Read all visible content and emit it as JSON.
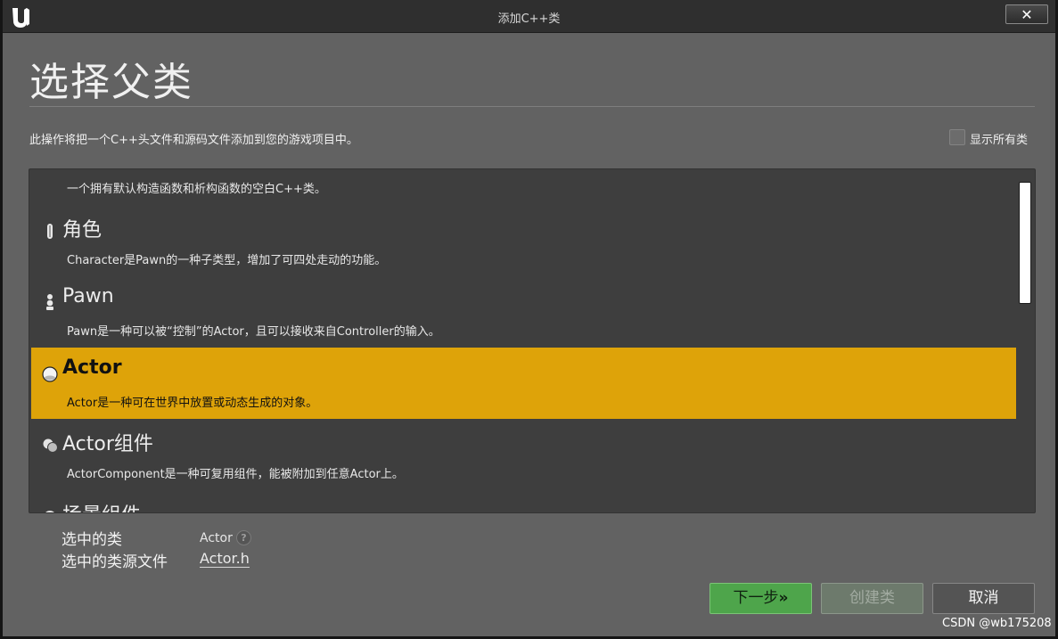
{
  "window": {
    "title": "添加C++类",
    "close_label": "✕"
  },
  "header": {
    "heading": "选择父类",
    "description": "此操作将把一个C++头文件和源码文件添加到您的游戏项目中。",
    "show_all_label": "显示所有类",
    "show_all_checked": false
  },
  "class_list": {
    "items": [
      {
        "name": "",
        "description": "一个拥有默认构造函数和析构函数的空白C++类。",
        "icon": "none-partial"
      },
      {
        "name": "角色",
        "description": "Character是Pawn的一种子类型，增加了可四处走动的功能。",
        "icon": "character-icon"
      },
      {
        "name": "Pawn",
        "description": "Pawn是一种可以被“控制”的Actor，且可以接收来自Controller的输入。",
        "icon": "pawn-icon"
      },
      {
        "name": "Actor",
        "description": "Actor是一种可在世界中放置或动态生成的对象。",
        "icon": "actor-icon",
        "selected": true
      },
      {
        "name": "Actor组件",
        "description": "ActorComponent是一种可复用组件，能被附加到任意Actor上。",
        "icon": "actor-component-icon"
      },
      {
        "name": "场景组件",
        "description": "",
        "icon": "scene-component-icon"
      }
    ]
  },
  "selection": {
    "class_label": "选中的类",
    "class_value": "Actor",
    "source_label": "选中的类源文件",
    "source_value": "Actor.h"
  },
  "buttons": {
    "next": "下一步",
    "next_arrow": "»",
    "create": "创建类",
    "cancel": "取消"
  },
  "watermark": "CSDN @wb175208",
  "colors": {
    "selected_row": "#dea309",
    "next_button": "#4ea54b",
    "background": "#626262",
    "list_background": "#3e3e3e"
  }
}
